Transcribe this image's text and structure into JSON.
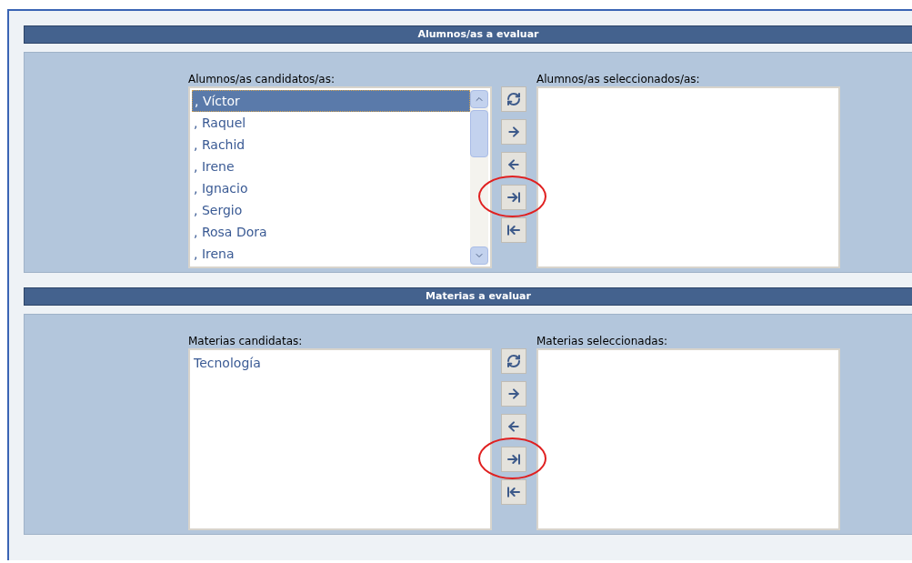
{
  "sections": [
    {
      "title": "Alumnos/as a evaluar",
      "candidates_label": "Alumnos/as candidatos/as:",
      "selected_label": "Alumnos/as seleccionados/as:",
      "scrollbar": true,
      "candidates": [
        {
          "text": ", Víctor",
          "selected": true
        },
        {
          "text": ", Raquel",
          "selected": false
        },
        {
          "text": ", Rachid",
          "selected": false
        },
        {
          "text": ", Irene",
          "selected": false
        },
        {
          "text": ", Ignacio",
          "selected": false
        },
        {
          "text": ", Sergio",
          "selected": false
        },
        {
          "text": ", Rosa Dora",
          "selected": false
        },
        {
          "text": ", Irena",
          "selected": false
        }
      ],
      "buttons": [
        {
          "kind": "refresh",
          "circled": false
        },
        {
          "kind": "add",
          "circled": false
        },
        {
          "kind": "remove",
          "circled": false
        },
        {
          "kind": "add_all",
          "circled": true
        },
        {
          "kind": "remove_all",
          "circled": false
        }
      ]
    },
    {
      "title": "Materias a evaluar",
      "candidates_label": "Materias candidatas:",
      "selected_label": "Materias seleccionadas:",
      "scrollbar": false,
      "candidates": [
        {
          "text": "Tecnología",
          "selected": false
        }
      ],
      "buttons": [
        {
          "kind": "refresh",
          "circled": false
        },
        {
          "kind": "add",
          "circled": false
        },
        {
          "kind": "remove",
          "circled": false
        },
        {
          "kind": "add_all",
          "circled": true
        },
        {
          "kind": "remove_all",
          "circled": false
        }
      ]
    }
  ]
}
